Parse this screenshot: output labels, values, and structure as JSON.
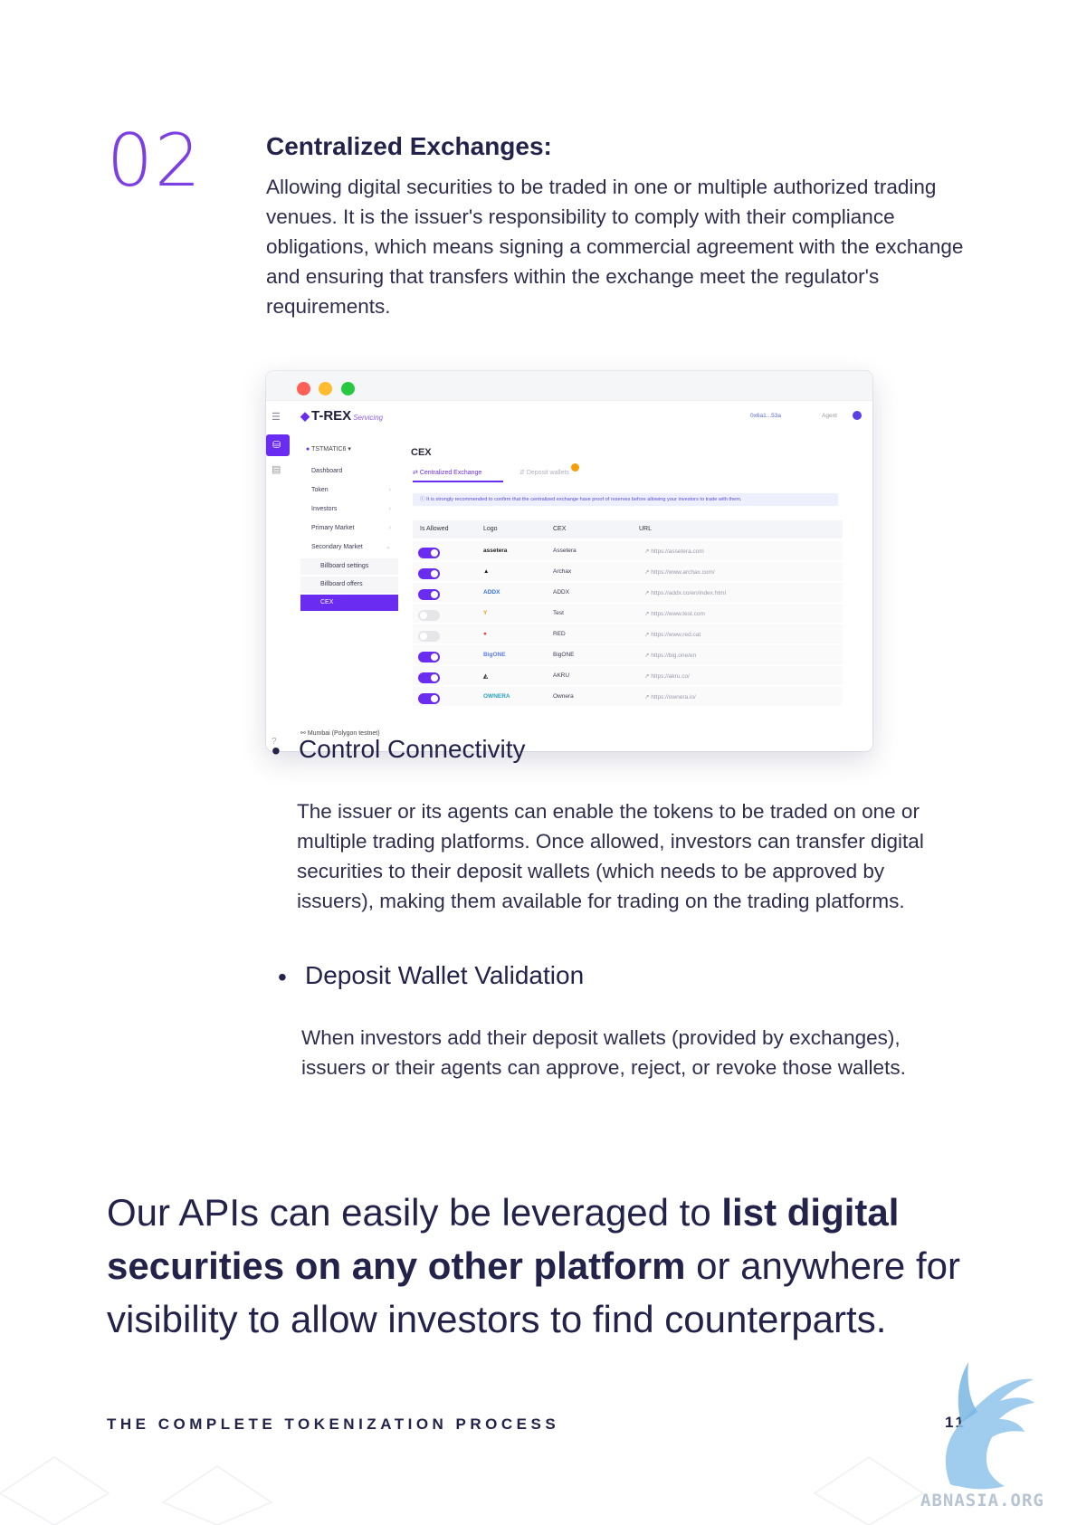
{
  "section": {
    "number": "02",
    "title": "Centralized Exchanges:",
    "body": "Allowing digital securities to be traded in one or multiple authorized trading venues. It is the issuer's responsibility to comply with their compliance obligations, which means signing a commercial agreement with the exchange and ensuring that transfers within the exchange meet the regulator's requirements."
  },
  "app": {
    "brand": "T-REX",
    "brand_sub": "Servicing",
    "wallet_address": "0x6a1...53a",
    "agent_label": "Agent",
    "token_selector": "TSTMATIC6",
    "sidebar": [
      {
        "label": "Dashboard",
        "active": false,
        "sub": false
      },
      {
        "label": "Token",
        "active": false,
        "sub": false
      },
      {
        "label": "Investors",
        "active": false,
        "sub": false
      },
      {
        "label": "Primary Market",
        "active": false,
        "sub": false
      },
      {
        "label": "Secondary Market",
        "active": false,
        "sub": false
      },
      {
        "label": "Billboard settings",
        "active": false,
        "sub": true
      },
      {
        "label": "Billboard offers",
        "active": false,
        "sub": true
      },
      {
        "label": "CEX",
        "active": true,
        "sub": true
      }
    ],
    "network": "Mumbai (Polygon testnet)",
    "page_title": "CEX",
    "tabs": [
      "Centralized Exchange",
      "Deposit wallets"
    ],
    "notice": "It is strongly recommended to confirm that the centralized exchange have proof of reserves before allowing your investors to trade with them.",
    "columns": [
      "Is Allowed",
      "Logo",
      "CEX",
      "URL"
    ],
    "rows": [
      {
        "allowed": true,
        "logo": "assetera",
        "cex": "Assetera",
        "url": "https://assetera.com"
      },
      {
        "allowed": true,
        "logo": "▲",
        "cex": "Archax",
        "url": "https://www.archax.com/"
      },
      {
        "allowed": true,
        "logo": "ADDX",
        "cex": "ADDX",
        "url": "https://addx.co/en/index.html"
      },
      {
        "allowed": false,
        "logo": "Y",
        "cex": "Test",
        "url": "https://www.test.com"
      },
      {
        "allowed": false,
        "logo": "●",
        "cex": "RED",
        "url": "https://www.red.cat"
      },
      {
        "allowed": true,
        "logo": "BigONE",
        "cex": "BigONE",
        "url": "https://big.one/en"
      },
      {
        "allowed": true,
        "logo": "◭",
        "cex": "AKRU",
        "url": "https://akru.co/"
      },
      {
        "allowed": true,
        "logo": "OWNERA",
        "cex": "Ownera",
        "url": "https://ownera.io/"
      }
    ],
    "logo_colors": [
      "#1a1a1a",
      "#1a1a2e",
      "#3b6fe0",
      "#d9a21b",
      "#d8443c",
      "#5b7cfa",
      "#333333",
      "#2aa0b8"
    ]
  },
  "bullets": [
    {
      "title": "Control Connectivity",
      "body": "The issuer or its agents can enable the tokens to be traded on one or multiple trading platforms. Once allowed, investors can transfer digital securities to their deposit wallets (which needs to be approved by issuers), making them available for trading on the trading platforms."
    },
    {
      "title": "Deposit Wallet Validation",
      "body": "When investors add their deposit wallets (provided by exchanges), issuers or their agents can approve, reject, or revoke those wallets."
    }
  ],
  "closing": {
    "part1": "Our APIs can easily be leveraged to ",
    "bold": "list digital securities on any other platform",
    "part2": " or anywhere for visibility to allow investors to find counterparts."
  },
  "footer": {
    "label": "THE COMPLETE TOKENIZATION PROCESS",
    "page": "11"
  },
  "watermark": "ABNASIA.ORG",
  "colors": {
    "accent": "#7b3fe4",
    "navy": "#23224a",
    "app_purple": "#6a2cf0"
  }
}
